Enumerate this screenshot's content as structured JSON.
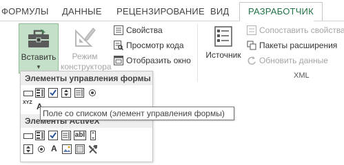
{
  "ribbon_tabs": [
    "ФОРМУЛЫ",
    "ДАННЫЕ",
    "РЕЦЕНЗИРОВАНИЕ",
    "ВИД",
    "РАЗРАБОТЧИК"
  ],
  "controls_group": {
    "insert_label": "Вставить",
    "design_mode_line1": "Режим",
    "design_mode_line2": "конструктора",
    "properties": "Свойства",
    "view_code": "Просмотр кода",
    "run_dialog": "Отобразить окно"
  },
  "xml_group": {
    "source": "Источник",
    "map_properties": "Сопоставить свойства",
    "expansion_packs": "Пакеты расширения",
    "refresh_data": "Обновить данные",
    "group_label": "XML"
  },
  "dropdown": {
    "form_controls_header": "Элементы управления формы",
    "activex_header": "Элементы ActiveX",
    "xyz_text": "XYZ",
    "label_a": "A",
    "abl_text": "abl"
  },
  "tooltip": "Поле со списком (элемент управления формы)",
  "colors": {
    "accent": "#217346",
    "hover_bg": "#c5e0c9",
    "disabled": "#a5a5a5"
  }
}
